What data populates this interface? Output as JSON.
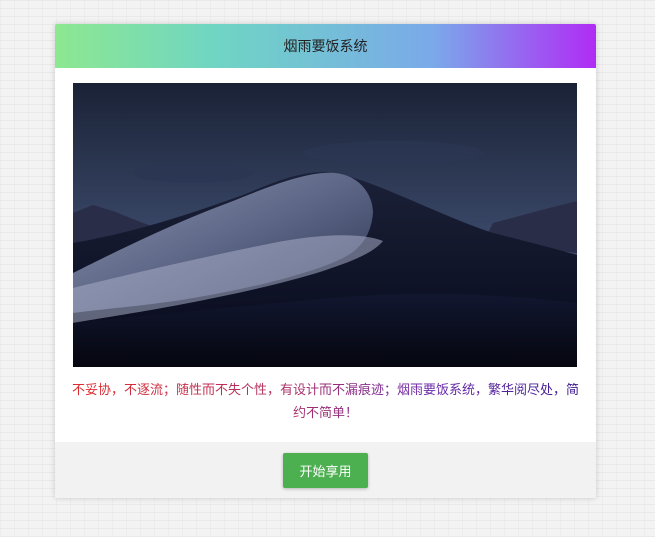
{
  "header": {
    "title": "烟雨要饭系统"
  },
  "hero": {
    "image": "night-desert-dunes"
  },
  "tagline": {
    "text": "不妥协，不逐流；随性而不失个性，有设计而不漏痕迹；烟雨要饭系统，繁华阅尽处，简约不简单！"
  },
  "footer": {
    "start_label": "开始享用"
  },
  "colors": {
    "header_gradient": [
      "#8de890",
      "#6fd5c4",
      "#7aa9ea",
      "#b02cf5"
    ],
    "button": "#4caf50",
    "tagline_gradient": [
      "#e32a2a",
      "#6a2aa8"
    ]
  }
}
